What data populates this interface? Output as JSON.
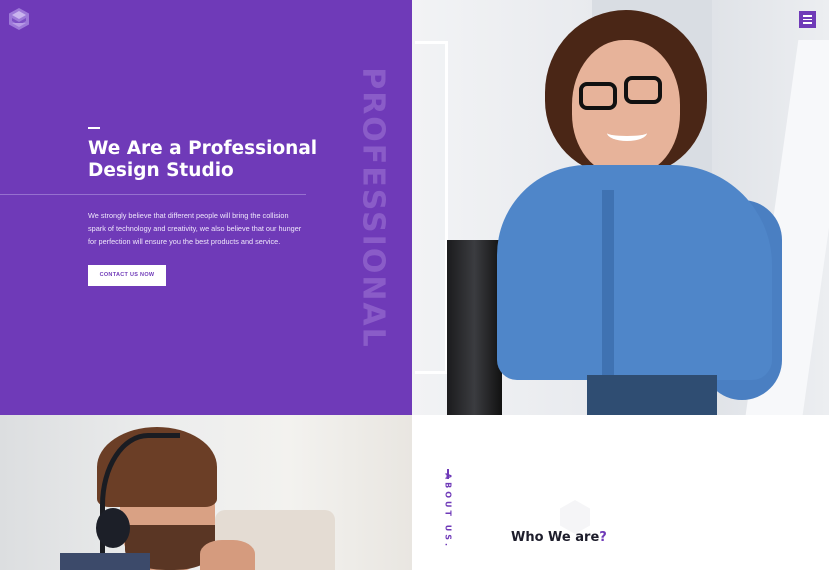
{
  "brand": {
    "logo_icon": "hexagon-s-logo-icon"
  },
  "hero": {
    "vertical_word": "PROFESSIONAL",
    "title_line_1": "We Are a Professional",
    "title_line_2": "Design Studio",
    "description_lines": [
      "We strongly believe that different people will bring the collision",
      "spark of technology and creativity, we also believe that our hunger",
      "for perfection will ensure you the best products and service."
    ],
    "cta_label": "CONTACT US NOW"
  },
  "nav": {
    "menu_icon": "hamburger-menu-icon"
  },
  "about": {
    "vertical_label": "ABOUT US.",
    "heading": "Who We are",
    "heading_mark": "?"
  },
  "colors": {
    "accent": "#6f3ab8",
    "accent_light": "#8a5cc8",
    "heading_dark": "#1d1d2b",
    "white": "#ffffff"
  }
}
